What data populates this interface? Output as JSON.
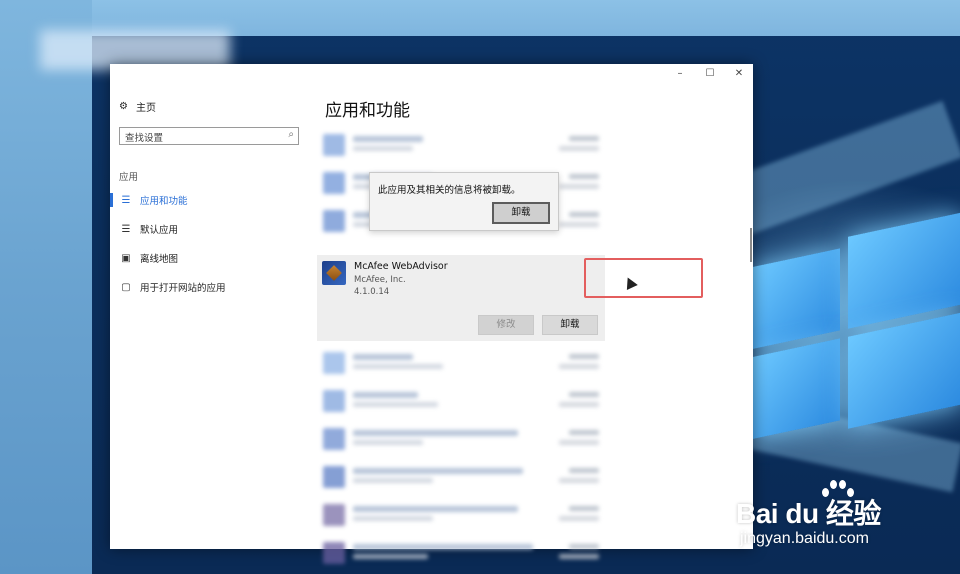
{
  "window": {
    "minimize_glyph": "–",
    "maximize_glyph": "☐",
    "close_glyph": "✕"
  },
  "sidebar": {
    "home_label": "主页",
    "home_icon": "gear-icon",
    "search_placeholder": "查找设置",
    "search_icon": "search-icon",
    "group_label": "应用",
    "items": [
      {
        "label": "应用和功能",
        "icon": "apps-list-icon",
        "glyph": "☰",
        "active": true
      },
      {
        "label": "默认应用",
        "icon": "default-apps-icon",
        "glyph": "☰",
        "active": false
      },
      {
        "label": "离线地图",
        "icon": "map-icon",
        "glyph": "▣",
        "active": false
      },
      {
        "label": "用于打开网站的应用",
        "icon": "open-website-icon",
        "glyph": "▢",
        "active": false
      }
    ]
  },
  "main": {
    "page_title": "应用和功能",
    "selected_app": {
      "name": "McAfee WebAdvisor",
      "publisher": "McAfee, Inc.",
      "version": "4.1.0.14",
      "modify_label": "修改",
      "uninstall_label": "卸载"
    }
  },
  "flyout": {
    "message": "此应用及其相关的信息将被卸载。",
    "confirm_label": "卸载"
  },
  "colors": {
    "accent": "#2a6fd6",
    "highlight_border": "#e35e5e"
  },
  "watermark": {
    "line1": "Bai du 经验",
    "line2": "jingyan.baidu.com"
  }
}
